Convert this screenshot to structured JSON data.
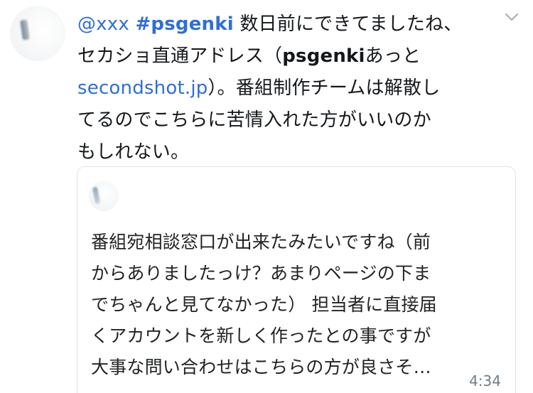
{
  "tweet": {
    "mention": "@xxx",
    "hashtag": "#psgenki",
    "lines": [
      {
        "prefix": "数日前にできてましたね、"
      },
      {
        "before": "セカショ直通アドレス（",
        "bold": "psgenki",
        "after": "あっと"
      },
      {
        "link": "secondshot.jp",
        "after": "）。番組制作チームは解散し"
      },
      {
        "text": "てるのでこちらに苦情入れた方がいいのか"
      },
      {
        "text": "もしれない。"
      }
    ]
  },
  "quote": {
    "lines": [
      "番組宛相談窓口が出来たみたいですね（前",
      "からありましたっけ？あまりページの下ま",
      "でちゃんと見てなかった） 担当者に直接届",
      "くアカウントを新しく作ったとの事ですが",
      "大事な問い合わせはこちらの方が良さそ…"
    ],
    "time": "4:34"
  },
  "colors": {
    "link": "#2f6ed7",
    "text": "#14171a",
    "muted": "#6f7b86",
    "border": "#dfe3e7"
  },
  "icons": {
    "menu": "chevron-down-icon"
  }
}
